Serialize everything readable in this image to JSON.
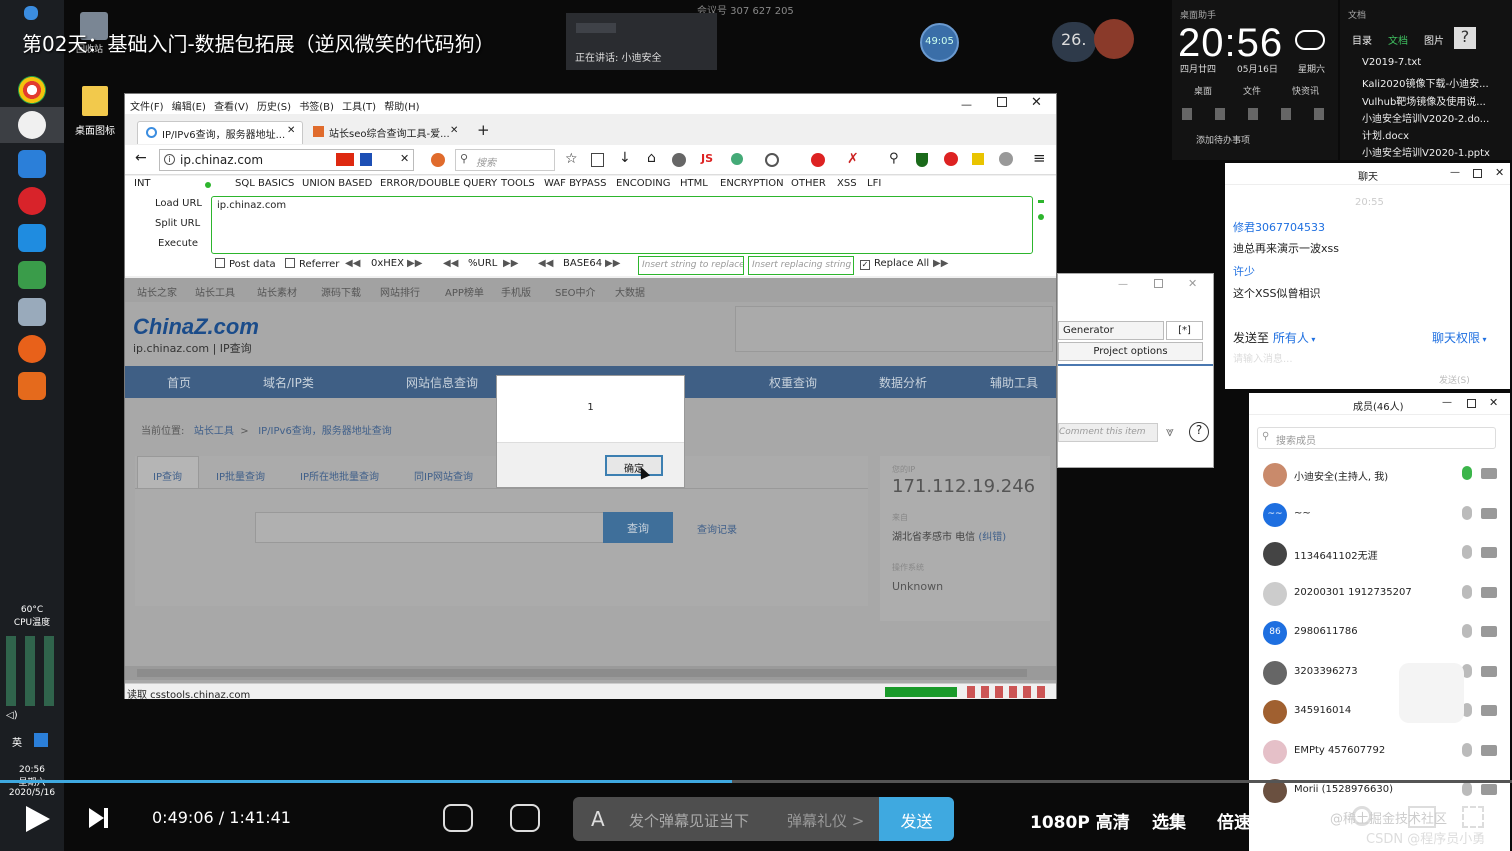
{
  "video_title": "第02天：基础入门-数据包拓展（逆风微笑的代码狗）",
  "meeting": {
    "id_label": "会议号 307 627 205",
    "speaking": "正在讲话: 小迪安全"
  },
  "timer_badge": "49:05",
  "weather": "26.",
  "clock": {
    "time": "20:56",
    "day": "四月廿四",
    "date": "05月16日",
    "weekday": "星期六",
    "widget_title": "桌面助手",
    "actions": [
      "桌面",
      "文件",
      "快资讯"
    ],
    "todo": "添加待办事项"
  },
  "docs": {
    "title": "文档",
    "tabs": [
      "目录",
      "文档",
      "图片"
    ],
    "files": [
      "V2019-7.txt",
      "Kali2020镜像下载-小迪安...",
      "Vulhub靶场镜像及使用说...",
      "小迪安全培训V2020-2.do...",
      "计划.docx",
      "小迪安全培训V2020-1.pptx"
    ]
  },
  "desktop": {
    "recycle": "回收站",
    "icon_label": "桌面图标"
  },
  "browser": {
    "menu": [
      "文件(F)",
      "编辑(E)",
      "查看(V)",
      "历史(S)",
      "书签(B)",
      "工具(T)",
      "帮助(H)"
    ],
    "tabs": [
      "IP/IPv6查询，服务器地址...",
      "站长seo综合查询工具-爱..."
    ],
    "url": "ip.chinaz.com",
    "search_placeholder": "搜索"
  },
  "hackbar": {
    "menu": [
      "INT",
      "SQL BASICS",
      "UNION BASED",
      "ERROR/DOUBLE QUERY",
      "TOOLS",
      "WAF BYPASS",
      "ENCODING",
      "HTML",
      "ENCRYPTION",
      "OTHER",
      "XSS",
      "LFI"
    ],
    "buttons": [
      "Load URL",
      "Split URL",
      "Execute"
    ],
    "textarea": "ip.chinaz.com",
    "post_data": "Post data",
    "referrer": "Referrer",
    "hex": "0xHEX",
    "url_enc": "%URL",
    "base64": "BASE64",
    "insert_replace": "Insert string to replace",
    "insert_replacing": "Insert replacing string",
    "replace_all": "Replace All"
  },
  "chinaz": {
    "top_links": [
      "站长之家",
      "站长工具",
      "站长素材",
      "源码下载",
      "网站排行",
      "APP榜单",
      "手机版",
      "SEO中介",
      "大数据"
    ],
    "logo": "ChinaZ.com",
    "logo_sub": "ip.chinaz.com | IP查询",
    "nav": [
      "首页",
      "域名/IP类",
      "网站信息查询",
      "权重查询",
      "数据分析",
      "辅助工具"
    ],
    "breadcrumb_label": "当前位置:",
    "breadcrumb": [
      "站长工具",
      "IP/IPv6查询，服务器地址查询"
    ],
    "tabs": [
      "IP查询",
      "IP批量查询",
      "IP所在地批量查询",
      "同IP网站查询"
    ],
    "query_btn": "查询",
    "history": "查询记录",
    "your_ip_label": "您的IP",
    "ip": "171.112.19.246",
    "source_label": "来自",
    "location": "湖北省孝感市 电信",
    "correct": "(纠错)",
    "os_label": "操作系统",
    "os": "Unknown"
  },
  "alert": {
    "message": "1",
    "ok": "确定"
  },
  "status": "读取 csstools.chinaz.com",
  "win2": {
    "generator": "Generator",
    "bracket": "[*]",
    "project_options": "Project options",
    "comment": "Comment this item"
  },
  "chat": {
    "title": "聊天",
    "time": "20:55",
    "messages": [
      {
        "user": "修君3067704533",
        "text": "迪总再来演示一波xss"
      },
      {
        "user": "许少",
        "text": "这个XSS似曾相识"
      }
    ],
    "send_to": "发送至",
    "recipient": "所有人",
    "perm": "聊天权限",
    "input_placeholder": "请输入消息...",
    "send": "发送(S)"
  },
  "members": {
    "title": "成员(46人)",
    "search_placeholder": "搜索成员",
    "list": [
      {
        "name": "小迪安全(主持人, 我)",
        "avatar": "",
        "color": "#c98a6b"
      },
      {
        "name": "~~",
        "avatar": "~~",
        "color": "#1e6fe0"
      },
      {
        "name": "1134641102无涯",
        "avatar": "",
        "color": "#444444"
      },
      {
        "name": "20200301 1912735207",
        "avatar": "",
        "color": "#cccccc"
      },
      {
        "name": "2980611786",
        "avatar": "86",
        "color": "#1e6fe0"
      },
      {
        "name": "3203396273",
        "avatar": "",
        "color": "#666666"
      },
      {
        "name": "345916014",
        "avatar": "",
        "color": "#a06030"
      },
      {
        "name": "EMPty 457607792",
        "avatar": "",
        "color": "#e5c0c8"
      },
      {
        "name": "Morii (1528976630)",
        "avatar": "",
        "color": "#6a5040"
      }
    ]
  },
  "sidebar": {
    "cpu_temp": "60°C",
    "cpu_label": "CPU温度",
    "lang": "英",
    "time": "20:56",
    "weekday": "星期六",
    "date": "2020/5/16"
  },
  "player": {
    "current": "0:49:06",
    "separator": "/",
    "total": "1:41:41",
    "progress": 0.484,
    "danmu_placeholder": "发个弹幕见证当下",
    "danmu_etiquette": "弹幕礼仪 >",
    "send": "发送",
    "quality": "1080P 高清",
    "episodes": "选集",
    "speed": "倍速",
    "watermark": "CSDN @程序员小勇",
    "watermark2": "@稀土掘金技术社区"
  }
}
